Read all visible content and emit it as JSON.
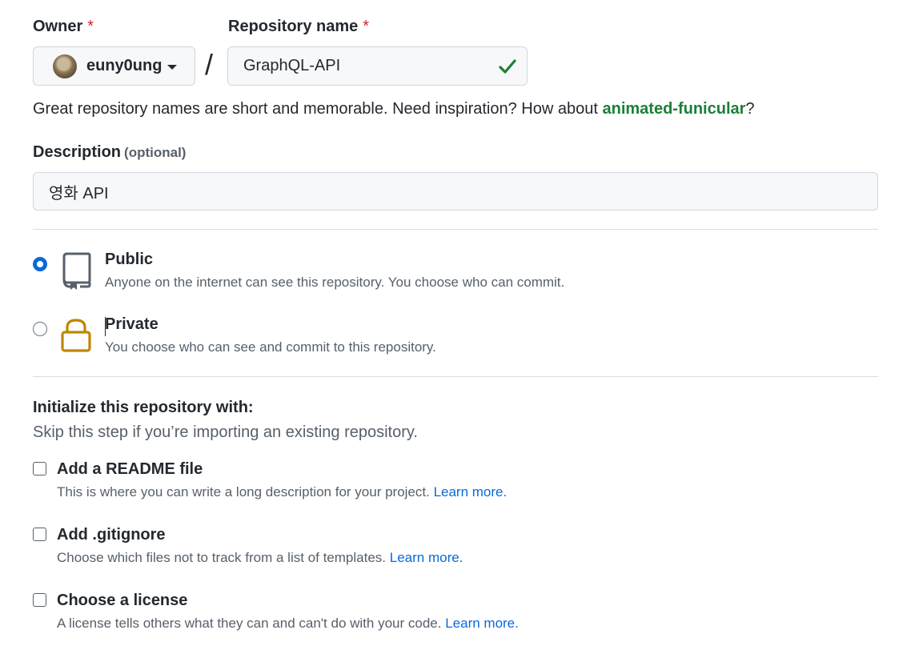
{
  "owner": {
    "label": "Owner",
    "required_mark": "*",
    "value": "euny0ung"
  },
  "slash": "/",
  "repo_name": {
    "label": "Repository name",
    "required_mark": "*",
    "value": "GraphQL-API",
    "valid_icon": "check-icon",
    "valid_color": "#1a7f37"
  },
  "hint": {
    "text": "Great repository names are short and memorable. Need inspiration? How about ",
    "suggestion": "animated-funicular",
    "suffix": "?"
  },
  "description": {
    "label": "Description",
    "optional": "(optional)",
    "value": "영화 API"
  },
  "visibility": [
    {
      "title": "Public",
      "desc": "Anyone on the internet can see this repository. You choose who can commit.",
      "selected": true,
      "icon": "repo-icon"
    },
    {
      "title": "Private",
      "desc": "You choose who can see and commit to this repository.",
      "selected": false,
      "icon": "lock-icon",
      "icon_color": "#bf8700"
    }
  ],
  "init": {
    "title": "Initialize this repository with:",
    "subtitle": "Skip this step if you’re importing an existing repository.",
    "options": [
      {
        "title": "Add a README file",
        "desc": "This is where you can write a long description for your project.",
        "link": "Learn more.",
        "checked": false
      },
      {
        "title": "Add .gitignore",
        "desc": "Choose which files not to track from a list of templates.",
        "link": "Learn more.",
        "checked": false
      },
      {
        "title": "Choose a license",
        "desc": "A license tells others what they can and can't do with your code.",
        "link": "Learn more.",
        "checked": false
      }
    ]
  }
}
